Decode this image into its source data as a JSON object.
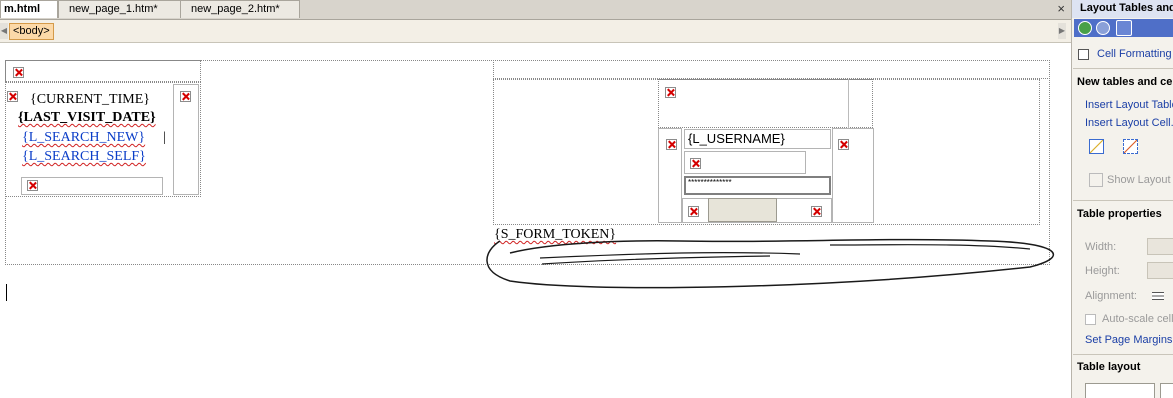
{
  "tabs": [
    {
      "label": "m.html",
      "active": true
    },
    {
      "label": "new_page_1.htm*",
      "active": false
    },
    {
      "label": "new_page_2.htm*",
      "active": false
    }
  ],
  "close_glyph": "×",
  "tag_selector": {
    "label": "<body>"
  },
  "canvas": {
    "current_time": "{CURRENT_TIME}",
    "last_visit_date": "{LAST_VISIT_DATE}",
    "search_new": "{L_SEARCH_NEW}",
    "separator": "|",
    "search_self": "{L_SEARCH_SELF}",
    "username": "{L_USERNAME}",
    "password_mask": "**************",
    "form_token": "{S_FORM_TOKEN}"
  },
  "task_pane": {
    "title": "Layout Tables and Cells",
    "cell_formatting": "Cell Formatting",
    "new_tables_header": "New tables and cells",
    "insert_layout_table": "Insert Layout Table...",
    "insert_layout_cell": "Insert Layout Cell...",
    "show_layout_tool": "Show Layout Tool",
    "table_properties_header": "Table properties",
    "width_label": "Width:",
    "height_label": "Height:",
    "alignment_label": "Alignment:",
    "autoscale_label": "Auto-scale cells with table",
    "set_page_margins": "Set Page Margins...",
    "table_layout_header": "Table layout"
  },
  "colors": {
    "nav_bar": "#4f6fc8",
    "tag_fill": "#fcd9a8",
    "broken_image": "#d40000"
  }
}
